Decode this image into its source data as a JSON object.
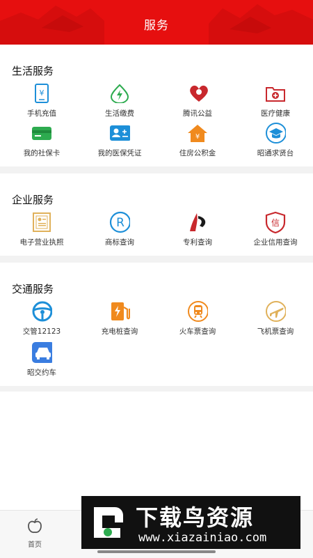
{
  "header": {
    "title": "服务"
  },
  "sections": [
    {
      "title": "生活服务",
      "items": [
        {
          "label": "手机充值",
          "icon": "mobile-recharge-icon"
        },
        {
          "label": "生活缴费",
          "icon": "utility-payment-icon"
        },
        {
          "label": "腾讯公益",
          "icon": "tencent-charity-icon"
        },
        {
          "label": "医疗健康",
          "icon": "medical-health-icon"
        },
        {
          "label": "我的社保卡",
          "icon": "social-security-card-icon"
        },
        {
          "label": "我的医保凭证",
          "icon": "medical-insurance-certificate-icon"
        },
        {
          "label": "住房公积金",
          "icon": "housing-fund-icon"
        },
        {
          "label": "昭通求贤台",
          "icon": "talent-recruitment-icon"
        }
      ]
    },
    {
      "title": "企业服务",
      "items": [
        {
          "label": "电子营业执照",
          "icon": "business-license-icon"
        },
        {
          "label": "商标查询",
          "icon": "trademark-icon"
        },
        {
          "label": "专利查询",
          "icon": "patent-icon"
        },
        {
          "label": "企业信用查询",
          "icon": "credit-query-icon"
        }
      ]
    },
    {
      "title": "交通服务",
      "items": [
        {
          "label": "交管12123",
          "icon": "steering-wheel-icon"
        },
        {
          "label": "充电桩查询",
          "icon": "charging-station-icon"
        },
        {
          "label": "火车票查询",
          "icon": "train-icon"
        },
        {
          "label": "飞机票查询",
          "icon": "airplane-icon"
        },
        {
          "label": "昭交约车",
          "icon": "car-icon"
        }
      ]
    }
  ],
  "tabbar": {
    "home_label": "首页"
  },
  "watermark": {
    "title": "下载鸟资源",
    "url": "www.xiazainiao.com"
  },
  "colors": {
    "brand_red": "#e60f0f",
    "blue": "#1d8fd8",
    "green": "#2dab4f",
    "orange": "#f08a1e",
    "dark_red": "#c8282d"
  }
}
